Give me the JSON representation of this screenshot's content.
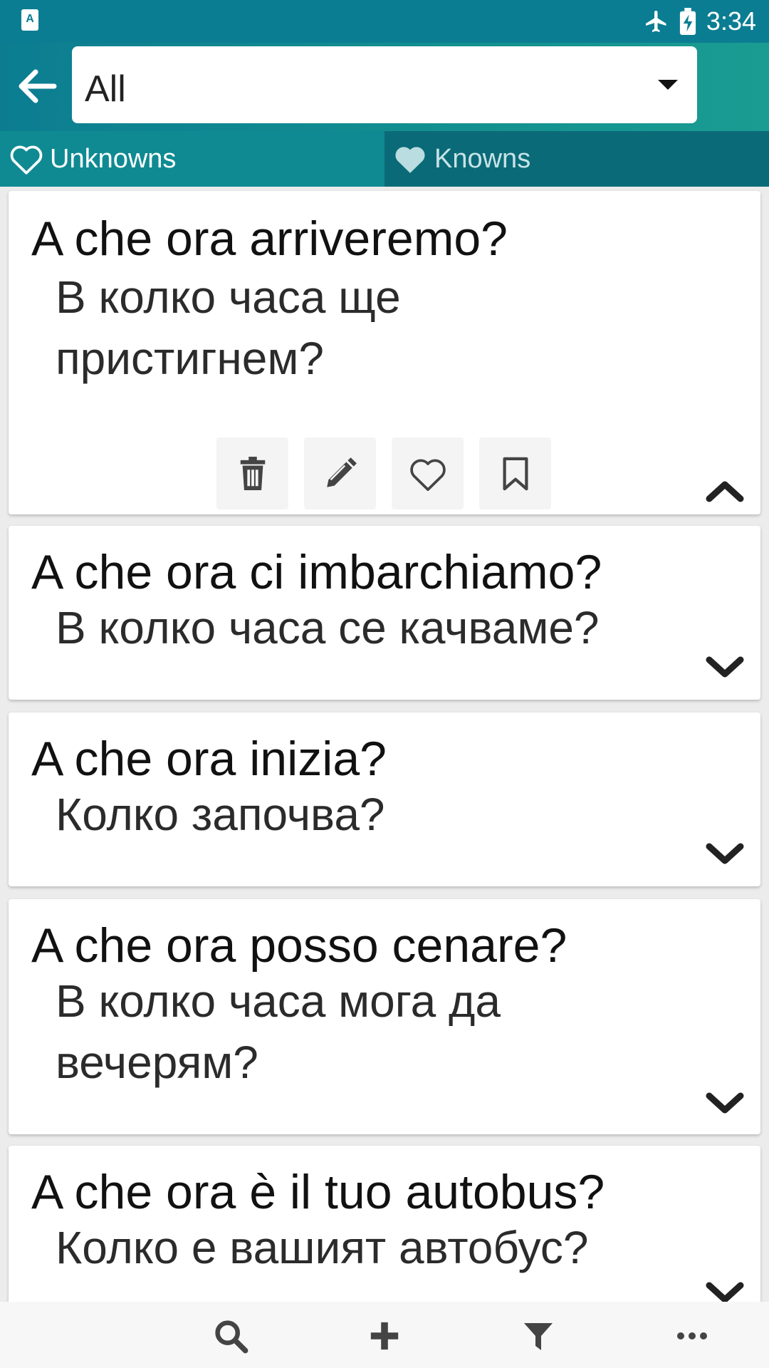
{
  "status_bar": {
    "time": "3:34",
    "app_icon_letter": "A",
    "icons": [
      "airplane-icon",
      "battery-charging-icon"
    ]
  },
  "app_bar": {
    "back_icon": "arrow-left-icon",
    "spinner_value": "All",
    "spinner_arrow_icon": "dropdown-arrow-icon"
  },
  "tabs": [
    {
      "label": "Unknowns",
      "icon": "heart-outline-icon",
      "selected": true
    },
    {
      "label": "Knowns",
      "icon": "heart-filled-icon",
      "selected": false
    }
  ],
  "phrases": [
    {
      "phrase": "A che ora arriveremo?",
      "translation": "В колко часа ще пристигнем?",
      "expanded": true
    },
    {
      "phrase": "A che ora ci imbarchiamo?",
      "translation": "В колко часа се качваме?",
      "expanded": false
    },
    {
      "phrase": "A che ora inizia?",
      "translation": "Колко започва?",
      "expanded": false
    },
    {
      "phrase": "A che ora posso cenare?",
      "translation": "В колко часа мога да вечерям?",
      "expanded": false
    },
    {
      "phrase": "A che ora è il tuo autobus?",
      "translation": "Колко е вашият автобус?",
      "expanded": false
    }
  ],
  "card_actions": [
    "trash-icon",
    "pencil-icon",
    "heart-outline-icon",
    "bookmark-icon"
  ],
  "bottom_bar": [
    "search-icon",
    "plus-icon",
    "filter-icon",
    "more-icon"
  ],
  "colors": {
    "primary": "#0b7d92",
    "tab_dark": "#0b6a78",
    "icon_gray": "#444444"
  }
}
